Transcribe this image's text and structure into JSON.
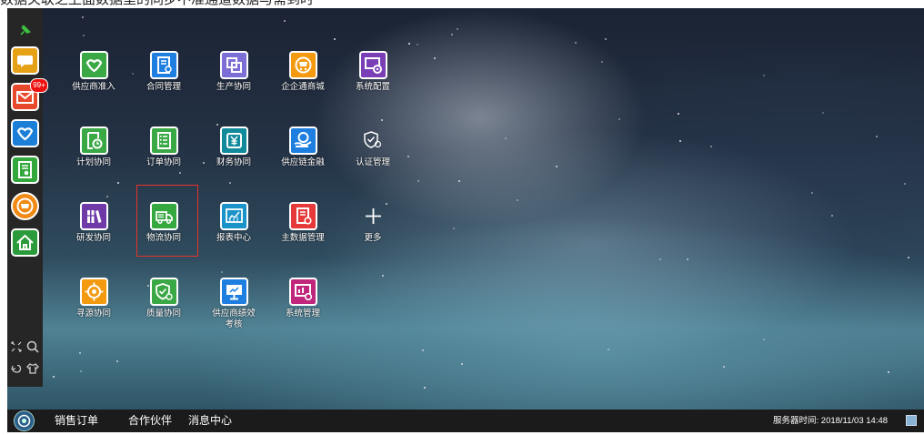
{
  "top_caption": "数据关联之上面数据里的同步不准通道数据与需到时",
  "sidebar": {
    "pin_icon": "pin-icon",
    "items": [
      {
        "name": "chat",
        "color": "#e6a217",
        "icon": "chat-bubble-icon"
      },
      {
        "name": "mail",
        "color": "#e8492c",
        "icon": "mail-icon",
        "badge": "99+"
      },
      {
        "name": "partner",
        "color": "#1b7fd8",
        "icon": "handshake-icon"
      },
      {
        "name": "document",
        "color": "#32a83c",
        "icon": "document-person-icon"
      },
      {
        "name": "shop",
        "color": "#f08a14",
        "icon": "shop-icon"
      },
      {
        "name": "home",
        "color": "#2a9a3a",
        "icon": "home-icon"
      }
    ],
    "bottom_icons": [
      "expand-icon",
      "search-icon",
      "refresh-icon",
      "shirt-icon"
    ]
  },
  "apps": [
    {
      "id": "supplier-access",
      "label": "供应商准入",
      "color": "#3aa845",
      "icon": "handshake-icon"
    },
    {
      "id": "contract",
      "label": "合同管理",
      "color": "#1e7fe0",
      "icon": "contract-icon"
    },
    {
      "id": "production",
      "label": "生产协同",
      "color": "#7b6fd6",
      "icon": "squares-icon"
    },
    {
      "id": "mall",
      "label": "企企通商城",
      "color": "#f39a11",
      "icon": "cart-icon"
    },
    {
      "id": "sysconfig",
      "label": "系统配置",
      "color": "#7a3fb6",
      "icon": "gear-screen-icon"
    },
    {
      "id": "plan",
      "label": "计划协同",
      "color": "#3aa845",
      "icon": "clock-doc-icon"
    },
    {
      "id": "order",
      "label": "订单协同",
      "color": "#3aa845",
      "icon": "checklist-icon"
    },
    {
      "id": "finance",
      "label": "财务协同",
      "color": "#118a9c",
      "icon": "yuan-icon"
    },
    {
      "id": "finance-chain",
      "label": "供应链金融",
      "color": "#1e7fe0",
      "icon": "coin-hand-icon"
    },
    {
      "id": "certification",
      "label": "认证管理",
      "color": "",
      "icon": "shield-check-icon"
    },
    {
      "id": "rnd",
      "label": "研发协同",
      "color": "#6f3aa8",
      "icon": "books-icon"
    },
    {
      "id": "logistics",
      "label": "物流协同",
      "color": "#35a840",
      "icon": "truck-icon"
    },
    {
      "id": "report",
      "label": "报表中心",
      "color": "#1a93c9",
      "icon": "chart-icon"
    },
    {
      "id": "masterdata",
      "label": "主数据管理",
      "color": "#e63a3a",
      "icon": "doc-gear-icon"
    },
    {
      "id": "more",
      "label": "更多",
      "color": "",
      "icon": "plus-icon"
    },
    {
      "id": "sourcing",
      "label": "寻源协同",
      "color": "#f39a11",
      "icon": "target-icon"
    },
    {
      "id": "quality",
      "label": "质量协同",
      "color": "#3aa845",
      "icon": "shield-gear-icon"
    },
    {
      "id": "performance",
      "label": "供应商绩效\n考核",
      "color": "#1e7fe0",
      "icon": "monitor-icon"
    },
    {
      "id": "sysmanage",
      "label": "系统管理",
      "color": "#c0267c",
      "icon": "chart-gear-icon"
    }
  ],
  "taskbar": {
    "start_icon": "start-logo-icon",
    "items": [
      "销售订单",
      "合作伙伴",
      "消息中心"
    ],
    "server_time_label": "服务器时间:",
    "server_time": "2018/11/03 14:48",
    "tray_icon": "monitor-tray-icon"
  }
}
